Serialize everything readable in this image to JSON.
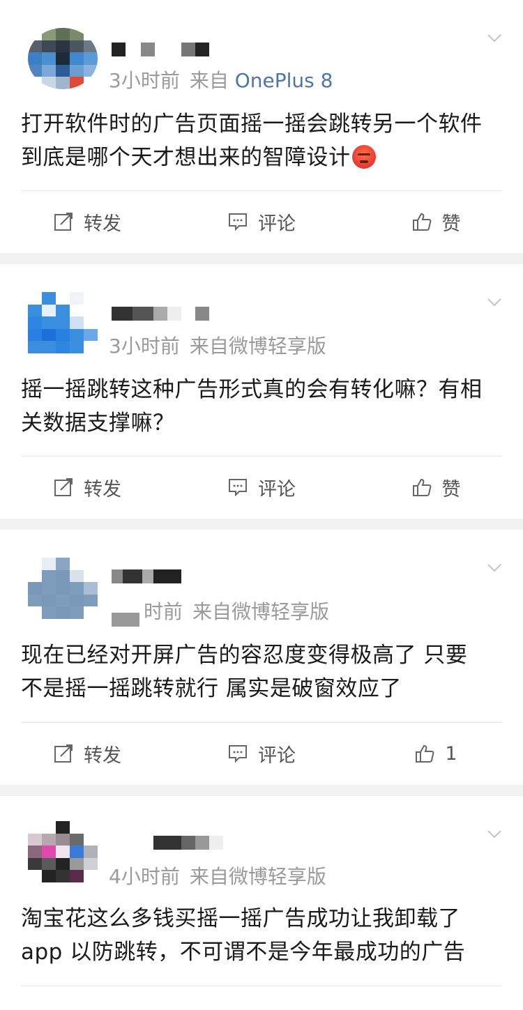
{
  "feed": {
    "posts": [
      {
        "time": "3小时前",
        "source": "来自",
        "device": "OnePlus 8",
        "text_line1": "打开软件时的广告页面摇一摇会跳转另一个软件",
        "text_line2": "到底是哪个天才想出来的智障设计",
        "emoji": "angry-face-emoji",
        "repost_label": "转发",
        "comment_label": "评论",
        "like_label": "赞"
      },
      {
        "time": "3小时前",
        "source": "来自微博轻享版",
        "text_line1": "摇一摇跳转这种广告形式真的会有转化嘛？有相",
        "text_line2": "关数据支撑嘛？",
        "repost_label": "转发",
        "comment_label": "评论",
        "like_label": "赞"
      },
      {
        "time": "时前",
        "source": "来自微博轻享版",
        "text_line1": "现在已经对开屏广告的容忍度变得极高了 只要",
        "text_line2": "不是摇一摇跳转就行 属实是破窗效应了",
        "repost_label": "转发",
        "comment_label": "评论",
        "like_label": "1"
      },
      {
        "time": "4小时前",
        "source": "来自微博轻享版",
        "text_line1": "淘宝花这么多钱买摇一摇广告成功让我卸载了",
        "text_line2": "app 以防跳转，不可谓不是今年最成功的广告"
      }
    ]
  },
  "colors": {
    "device_link": "#4a76a8",
    "meta_gray": "#9a9a9a",
    "feed_background": "#f2f2f2"
  },
  "icons": [
    "chevron-down-icon",
    "repost-icon",
    "comment-icon",
    "like-icon"
  ]
}
